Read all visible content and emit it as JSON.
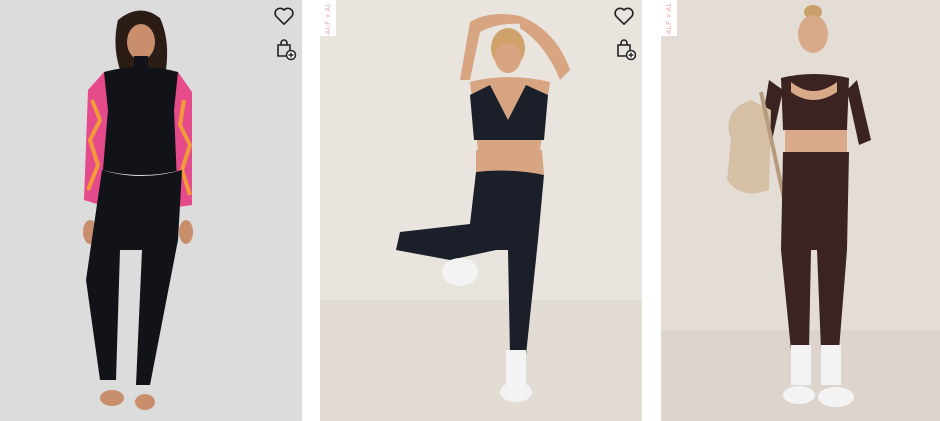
{
  "products": [
    {
      "id_label": "card-1",
      "badge": "",
      "bg_color": "#dcdcdc",
      "garment_color": "#111318",
      "sleeve_color": "#e54a8a"
    },
    {
      "id_label": "card-2",
      "badge": "ALF x AL",
      "bg_color": "#e9e4de",
      "garment_color": "#1a1f2a"
    },
    {
      "id_label": "card-3",
      "badge": "ALF x AL",
      "bg_color": "#e4ddd6",
      "garment_color": "#3a2320"
    }
  ],
  "icons": {
    "wishlist": "heart-icon",
    "quick_add": "bag-plus-icon"
  }
}
